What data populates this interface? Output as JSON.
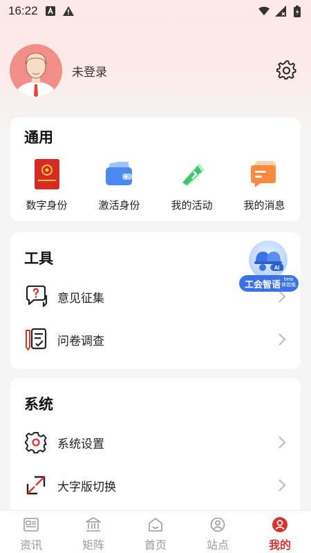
{
  "status": {
    "time": "16:22",
    "left_icons": [
      "a-badge-icon",
      "warning-icon"
    ],
    "right_icons": [
      "wifi-icon",
      "signal-icon",
      "battery-icon"
    ]
  },
  "profile": {
    "login_text": "未登录",
    "avatar_bg": "#f28e87"
  },
  "general": {
    "title": "通用",
    "items": [
      {
        "label": "数字身份",
        "icon": "id-card-icon"
      },
      {
        "label": "激活身份",
        "icon": "wallet-icon"
      },
      {
        "label": "我的活动",
        "icon": "flag-icon"
      },
      {
        "label": "我的消息",
        "icon": "message-icon"
      }
    ]
  },
  "tools": {
    "title": "工具",
    "items": [
      {
        "label": "意见征集",
        "icon": "feedback-icon"
      },
      {
        "label": "问卷调查",
        "icon": "survey-icon"
      }
    ]
  },
  "ai_assistant": {
    "label": "工会智语",
    "badge": "AI",
    "beta_top": "beta",
    "beta_bottom": "体验版"
  },
  "system": {
    "title": "系统",
    "items": [
      {
        "label": "系统设置",
        "icon": "gear-icon"
      },
      {
        "label": "大字版切换",
        "icon": "resize-icon"
      }
    ]
  },
  "tabs": [
    {
      "label": "资讯",
      "icon": "news-icon",
      "active": false
    },
    {
      "label": "矩阵",
      "icon": "bank-icon",
      "active": false
    },
    {
      "label": "首页",
      "icon": "home-icon",
      "active": false
    },
    {
      "label": "站点",
      "icon": "user-circle-icon",
      "active": false
    },
    {
      "label": "我的",
      "icon": "profile-icon",
      "active": true
    }
  ],
  "colors": {
    "accent": "#d9342b",
    "ai_blue": "#3a73e8"
  }
}
